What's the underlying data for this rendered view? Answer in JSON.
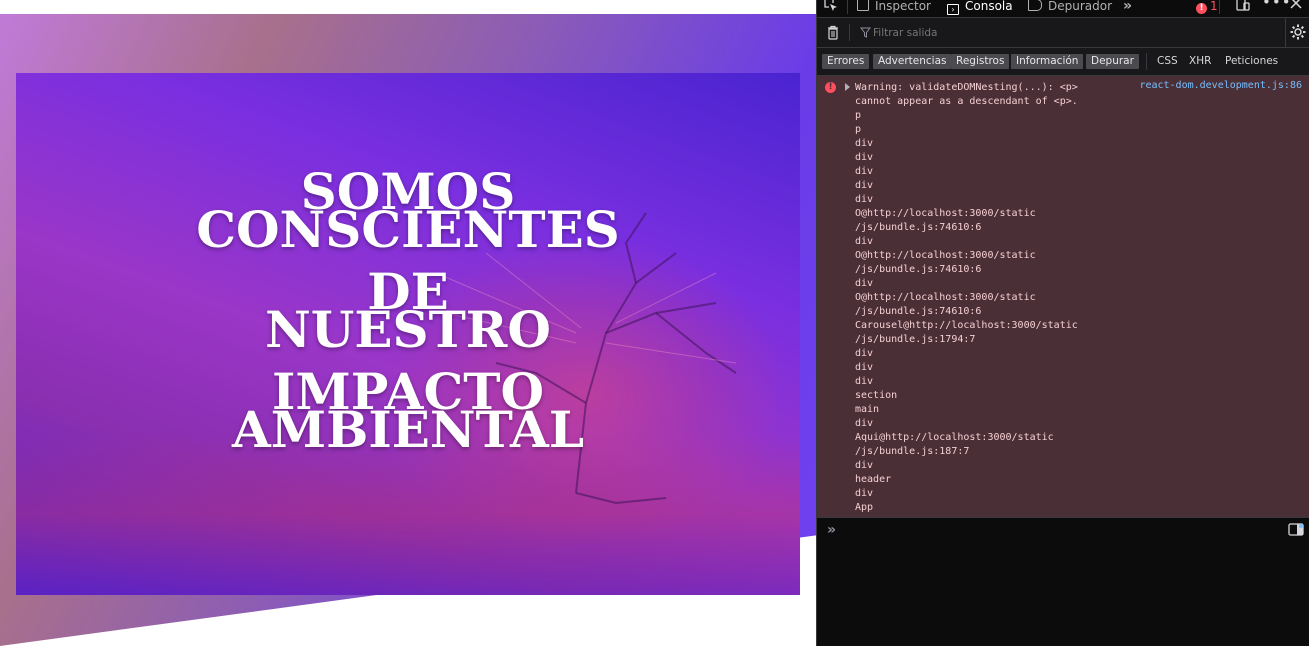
{
  "hero": {
    "title_lines": [
      "SOMOS",
      "CONSCIENTES",
      "DE",
      "NUESTRO",
      "IMPACTO",
      "AMBIENTAL"
    ]
  },
  "devtools": {
    "tabs": {
      "inspector": "Inspector",
      "console": "Consola",
      "debugger": "Depurador"
    },
    "error_count": "1",
    "filter_placeholder": "Filtrar salida",
    "level_buttons": [
      "Errores",
      "Advertencias",
      "Registros",
      "Información",
      "Depurar"
    ],
    "category_buttons": [
      "CSS",
      "XHR",
      "Peticiones"
    ],
    "message": {
      "source": "react-dom.development.js:86",
      "lines": [
        "Warning: validateDOMNesting(...): <p>",
        "cannot appear as a descendant of <p>.",
        "p",
        "p",
        "div",
        "div",
        "div",
        "div",
        "div",
        "O@http://localhost:3000/static",
        "/js/bundle.js:74610:6",
        "div",
        "O@http://localhost:3000/static",
        "/js/bundle.js:74610:6",
        "div",
        "O@http://localhost:3000/static",
        "/js/bundle.js:74610:6",
        "Carousel@http://localhost:3000/static",
        "/js/bundle.js:1794:7",
        "div",
        "div",
        "div",
        "section",
        "main",
        "div",
        "Aqui@http://localhost:3000/static",
        "/js/bundle.js:187:7",
        "div",
        "header",
        "div",
        "App"
      ]
    },
    "colors": {
      "error_bg": "#4b2f36",
      "error_text": "#f5d0d3",
      "link": "#75bfff",
      "panel": "#0c0c0d"
    }
  }
}
